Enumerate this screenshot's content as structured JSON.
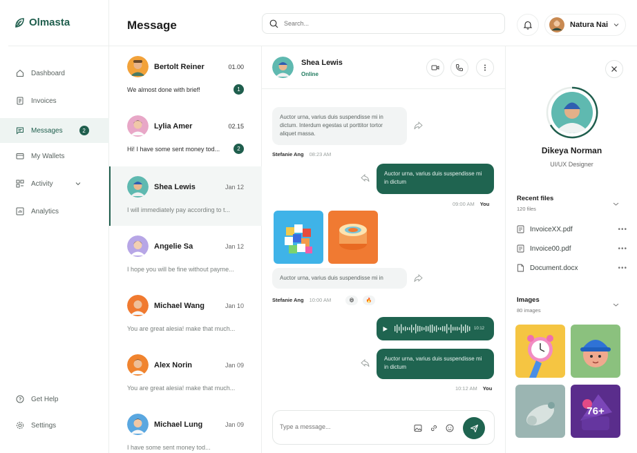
{
  "app": {
    "name": "Olmasta"
  },
  "colors": {
    "accent": "#1f5e4d",
    "active_bg": "#eef4f2",
    "bubble_out": "#1f6450"
  },
  "sidebar": {
    "items": [
      {
        "label": "Dashboard",
        "icon": "home-icon"
      },
      {
        "label": "Invoices",
        "icon": "invoice-icon"
      },
      {
        "label": "Messages",
        "icon": "message-icon",
        "badge": "2",
        "active": true
      },
      {
        "label": "My Wallets",
        "icon": "wallet-icon"
      },
      {
        "label": "Activity",
        "icon": "activity-icon",
        "expandable": true
      },
      {
        "label": "Analytics",
        "icon": "analytics-icon"
      }
    ],
    "bottom": [
      {
        "label": "Get Help",
        "icon": "help-icon"
      },
      {
        "label": "Settings",
        "icon": "settings-icon"
      }
    ]
  },
  "header": {
    "title": "Message",
    "search_placeholder": "Search...",
    "user_name": "Natura Nai"
  },
  "conversations": [
    {
      "name": "Bertolt Reiner",
      "time": "01.00",
      "preview": "We almost done with brief!",
      "unread": "1"
    },
    {
      "name": "Lylia Amer",
      "time": "02.15",
      "preview": "Hi! I have some sent money tod...",
      "unread": "2"
    },
    {
      "name": "Shea Lewis",
      "time": "Jan 12",
      "preview": "I will immediately pay according to t...",
      "active": true
    },
    {
      "name": "Angelie Sa",
      "time": "Jan 12",
      "preview": "I hope you will be fine without payme..."
    },
    {
      "name": "Michael Wang",
      "time": "Jan 10",
      "preview": "You are great alesia! make that much..."
    },
    {
      "name": "Alex Norin",
      "time": "Jan 09",
      "preview": "You are great alesia! make that much..."
    },
    {
      "name": "Michael Lung",
      "time": "Jan 09",
      "preview": "I have some sent money tod..."
    }
  ],
  "chat": {
    "contact_name": "Shea Lewis",
    "status": "Online",
    "messages": {
      "m1_text": "Auctor urna, varius duis suspendisse mi in dictum. Interdum egestas ut porttitor tortor aliquet massa.",
      "m1_sender": "Stefanie Ang",
      "m1_time": "08:23 AM",
      "m2_text": "Auctor urna, varius duis suspendisse mi in dictum",
      "m2_time": "09:00 AM",
      "m2_sender": "You",
      "m3_text": "Auctor urna, varius duis suspendisse mi in",
      "m3_sender": "Stefanie Ang",
      "m3_time": "10:00 AM",
      "voice_duration": "10:12",
      "m4_text": "Auctor urna, varius duis suspendisse mi in dictum",
      "m4_time": "10:12 AM",
      "m4_sender": "You"
    },
    "composer_placeholder": "Type a message..."
  },
  "profile": {
    "name": "Dikeya Norman",
    "role": "UI/UX Designer",
    "recent_files_title": "Recent files",
    "recent_files_count": "120 files",
    "files": [
      "InvoiceXX.pdf",
      "Invoice00.pdf",
      "Document.docx"
    ],
    "images_title": "Images",
    "images_count": "80 images",
    "more_images": "76+"
  }
}
